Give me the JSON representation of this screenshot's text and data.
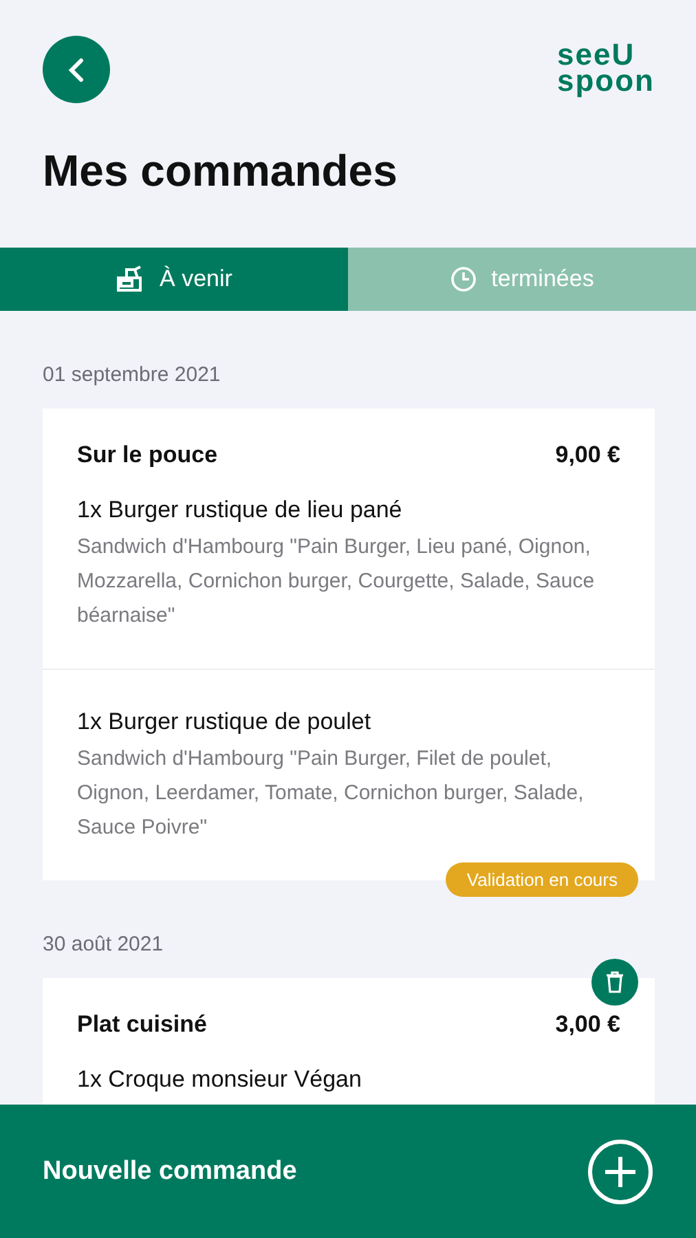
{
  "header": {
    "logo_top": "seeU",
    "logo_bottom": "spoon",
    "title": "Mes commandes"
  },
  "tabs": [
    {
      "label": "À venir",
      "kind": "shop",
      "selected": true
    },
    {
      "label": "terminées",
      "kind": "clock",
      "selected": false
    }
  ],
  "orders": [
    {
      "date": "01 septembre 2021",
      "deletable": false,
      "title": "Sur le pouce",
      "price": "9,00 €",
      "status": "Validation en cours",
      "items": [
        {
          "name": "1x Burger rustique de lieu pané",
          "description": "Sandwich d'Hambourg \"Pain Burger, Lieu pané, Oignon, Mozzarella, Cornichon burger, Courgette, Salade, Sauce béarnaise\""
        },
        {
          "name": "1x Burger rustique de poulet",
          "description": "Sandwich d'Hambourg \"Pain Burger, Filet de poulet, Oignon, Leerdamer, Tomate, Cornichon burger, Salade, Sauce Poivre\""
        }
      ]
    },
    {
      "date": "30 août 2021",
      "deletable": true,
      "title": "Plat cuisiné",
      "price": "3,00 €",
      "items": [
        {
          "name": "1x Croque monsieur Végan"
        }
      ]
    }
  ],
  "new_order": {
    "label": "Nouvelle commande"
  }
}
